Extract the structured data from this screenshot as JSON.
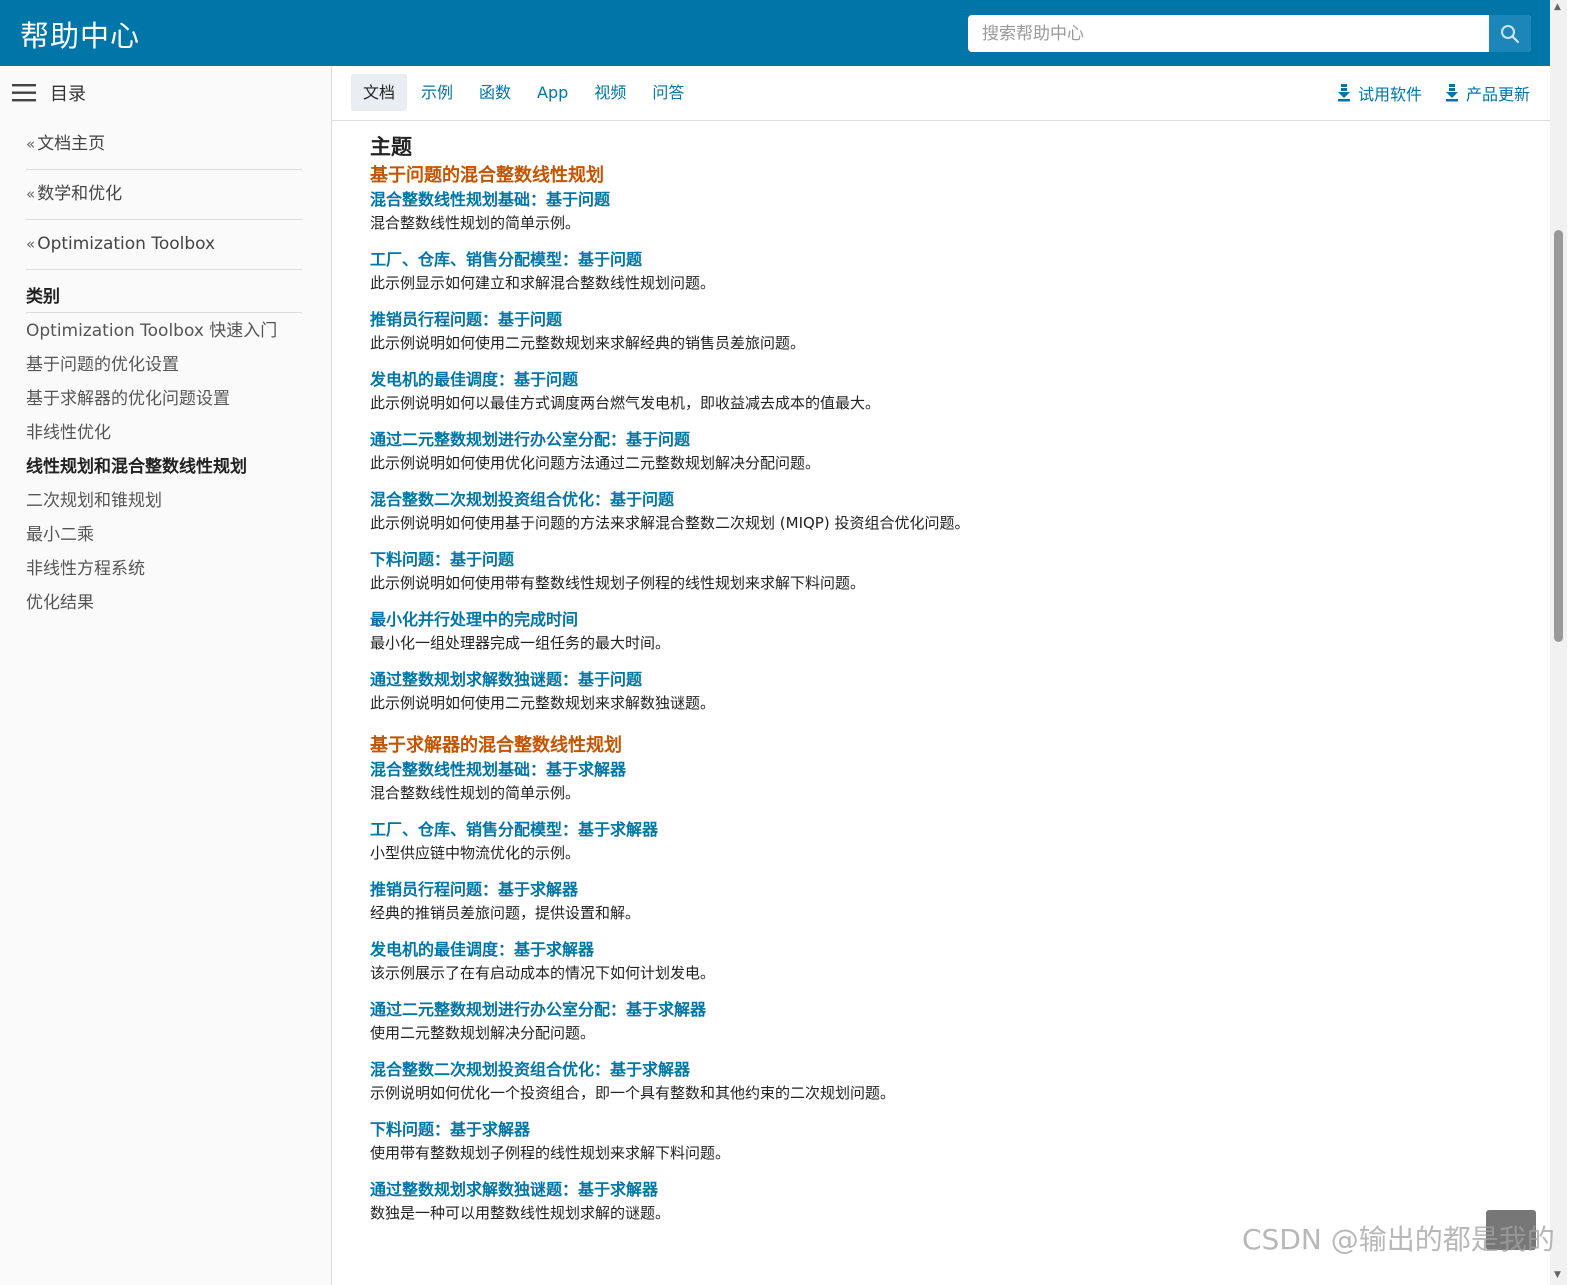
{
  "header": {
    "title": "帮助中心",
    "search_placeholder": "搜索帮助中心"
  },
  "sidebar": {
    "toc_label": "目录",
    "breadcrumbs": [
      "文档主页",
      "数学和优化",
      "Optimization Toolbox"
    ],
    "category_heading": "类别",
    "categories": [
      "Optimization Toolbox 快速入门",
      "基于问题的优化设置",
      "基于求解器的优化问题设置",
      "非线性优化",
      "线性规划和混合整数线性规划",
      "二次规划和锥规划",
      "最小二乘",
      "非线性方程系统",
      "优化结果"
    ],
    "active_category": "线性规划和混合整数线性规划"
  },
  "tabs": {
    "items": [
      "文档",
      "示例",
      "函数",
      "App",
      "视频",
      "问答"
    ],
    "active": "文档",
    "actions": [
      "试用软件",
      "产品更新"
    ]
  },
  "main": {
    "topic_title": "主题",
    "groups": [
      {
        "title": "基于问题的混合整数线性规划",
        "entries": [
          {
            "link": "混合整数线性规划基础：基于问题",
            "desc": "混合整数线性规划的简单示例。"
          },
          {
            "link": "工厂、仓库、销售分配模型：基于问题",
            "desc": "此示例显示如何建立和求解混合整数线性规划问题。"
          },
          {
            "link": "推销员行程问题：基于问题",
            "desc": "此示例说明如何使用二元整数规划来求解经典的销售员差旅问题。"
          },
          {
            "link": "发电机的最佳调度：基于问题",
            "desc": "此示例说明如何以最佳方式调度两台燃气发电机，即收益减去成本的值最大。"
          },
          {
            "link": "通过二元整数规划进行办公室分配：基于问题",
            "desc": "此示例说明如何使用优化问题方法通过二元整数规划解决分配问题。"
          },
          {
            "link": "混合整数二次规划投资组合优化：基于问题",
            "desc": "此示例说明如何使用基于问题的方法来求解混合整数二次规划 (MIQP) 投资组合优化问题。"
          },
          {
            "link": "下料问题：基于问题",
            "desc": "此示例说明如何使用带有整数线性规划子例程的线性规划来求解下料问题。"
          },
          {
            "link": "最小化并行处理中的完成时间",
            "desc": "最小化一组处理器完成一组任务的最大时间。"
          },
          {
            "link": "通过整数规划求解数独谜题：基于问题",
            "desc": "此示例说明如何使用二元整数规划来求解数独谜题。"
          }
        ]
      },
      {
        "title": "基于求解器的混合整数线性规划",
        "entries": [
          {
            "link": "混合整数线性规划基础：基于求解器",
            "desc": "混合整数线性规划的简单示例。"
          },
          {
            "link": "工厂、仓库、销售分配模型：基于求解器",
            "desc": "小型供应链中物流优化的示例。"
          },
          {
            "link": "推销员行程问题：基于求解器",
            "desc": "经典的推销员差旅问题，提供设置和解。"
          },
          {
            "link": "发电机的最佳调度：基于求解器",
            "desc": "该示例展示了在有启动成本的情况下如何计划发电。"
          },
          {
            "link": "通过二元整数规划进行办公室分配：基于求解器",
            "desc": "使用二元整数规划解决分配问题。"
          },
          {
            "link": "混合整数二次规划投资组合优化：基于求解器",
            "desc": "示例说明如何优化一个投资组合，即一个具有整数和其他约束的二次规划问题。"
          },
          {
            "link": "下料问题：基于求解器",
            "desc": "使用带有整数规划子例程的线性规划来求解下料问题。"
          },
          {
            "link": "通过整数规划求解数独谜题：基于求解器",
            "desc": "数独是一种可以用整数线性规划求解的谜题。"
          }
        ]
      }
    ]
  },
  "watermark": "CSDN @输出的都是我的",
  "colors": {
    "header_bg": "#0076a8",
    "link": "#0076a8",
    "group_title": "#c45400"
  }
}
